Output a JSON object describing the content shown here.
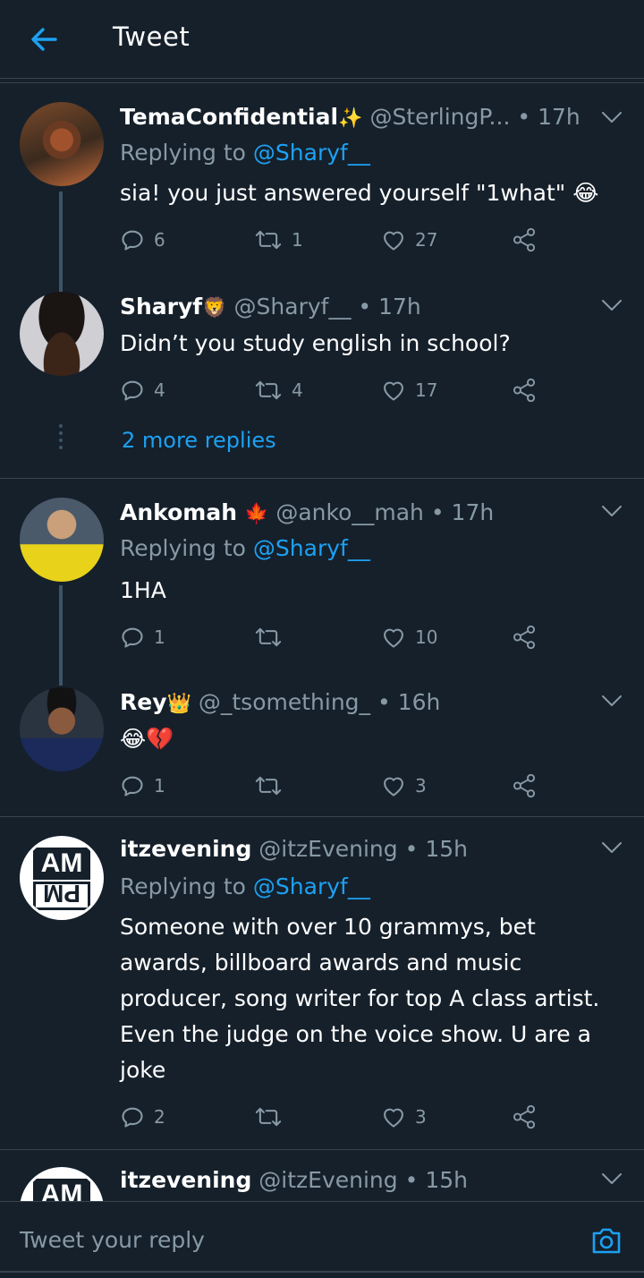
{
  "header": {
    "title": "Tweet",
    "back_icon": "arrow-left-icon",
    "accent": "#1da1f2"
  },
  "tweets": [
    {
      "name": "TemaConfidential",
      "name_emoji": "✨",
      "handle": "@SterlingP...",
      "time": "17h",
      "replying_prefix": "Replying to",
      "replying_to": "@Sharyf__",
      "text": "sia! you just answered yourself \"1what\" 😂",
      "replies": "6",
      "retweets": "1",
      "likes": "27"
    },
    {
      "name": "Sharyf",
      "name_emoji": "🦁",
      "handle": "@Sharyf__",
      "time": "17h",
      "text": "Didn’t you study english in school?",
      "replies": "4",
      "retweets": "4",
      "likes": "17"
    },
    {
      "more_replies": "2 more replies"
    },
    {
      "name": "Ankomah",
      "name_emoji": "🍁",
      "handle": "@anko__mah",
      "time": "17h",
      "replying_prefix": "Replying to",
      "replying_to": "@Sharyf__",
      "text": "1HA",
      "replies": "1",
      "retweets": "",
      "likes": "10"
    },
    {
      "name": "Rey",
      "name_emoji": "👑",
      "handle": "@_tsomething_",
      "time": "16h",
      "text": "😂💔",
      "replies": "1",
      "retweets": "",
      "likes": "3"
    },
    {
      "name": "itzevening",
      "handle": "@itzEvening",
      "time": "15h",
      "avatar_text_top": "AM",
      "avatar_text_bottom": "PM",
      "replying_prefix": "Replying to",
      "replying_to": "@Sharyf__",
      "text": "Someone with over 10 grammys, bet awards, billboard awards and music producer, song writer for top A class artist. Even the judge on the voice show. U are a joke",
      "replies": "2",
      "retweets": "",
      "likes": "3"
    },
    {
      "name": "itzevening",
      "handle": "@itzEvening",
      "time": "15h",
      "avatar_text_top": "AM"
    }
  ],
  "dot_separator": "•",
  "reply_bar": {
    "placeholder": "Tweet your reply",
    "camera_icon": "camera-icon"
  },
  "colors": {
    "background": "#15202b",
    "divider": "#38444d",
    "muted_text": "#8899a6",
    "link": "#1da1f2"
  }
}
